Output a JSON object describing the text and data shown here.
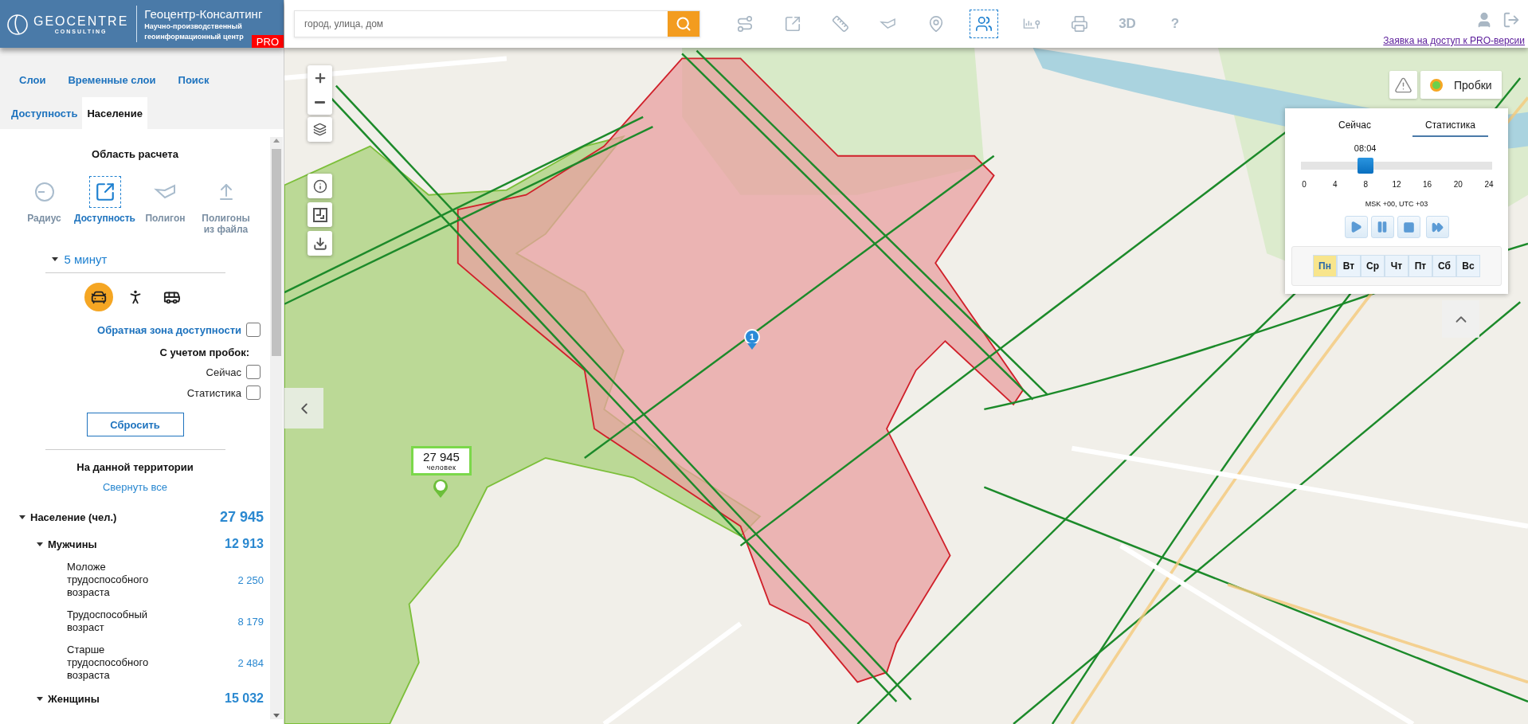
{
  "header": {
    "brand": "GEOCENTRE",
    "brand_sub": "CONSULTING",
    "title": "Геоцентр-Консалтинг",
    "subtitle_1": "Научно-производственный",
    "subtitle_2": "геоинформационный центр",
    "badge": "PRO"
  },
  "search": {
    "placeholder": "город, улица, дом"
  },
  "toolbar": {
    "tools": [
      {
        "selected": false
      },
      {
        "selected": false
      },
      {
        "selected": false
      },
      {
        "selected": false
      },
      {
        "selected": false
      },
      {
        "selected": true
      },
      {
        "selected": false
      },
      {
        "selected": false
      }
    ],
    "text_tools": [
      {
        "label": "3D"
      },
      {
        "label": "?"
      }
    ],
    "pro_link": "Заявка на доступ к PRO-версии"
  },
  "sidebar": {
    "tabs_row_1": [
      {
        "label": "Слои",
        "selected": false
      },
      {
        "label": "Временные слои",
        "selected": false
      },
      {
        "label": "Поиск",
        "selected": false
      }
    ],
    "tabs_row_2": [
      {
        "label": "Доступность",
        "selected": false
      },
      {
        "label": "Население",
        "selected": true
      }
    ],
    "area_title": "Область расчета",
    "area_modes": [
      {
        "label": "Радиус",
        "selected": false
      },
      {
        "label": "Доступность",
        "selected": true
      },
      {
        "label": "Полигон",
        "selected": false
      },
      {
        "label": "Полигоны из файла",
        "selected": false
      }
    ],
    "duration": "5 минут",
    "transport": [
      {
        "selected": true
      },
      {
        "selected": false
      },
      {
        "selected": false
      }
    ],
    "reverse_zone": {
      "label": "Обратная зона доступности",
      "checked": false
    },
    "traffic_title": "С учетом пробок:",
    "traffic_options": [
      {
        "label": "Сейчас",
        "checked": false
      },
      {
        "label": "Статистика",
        "checked": false
      }
    ],
    "reset_button": "Сбросить",
    "stats_title": "На данной территории",
    "collapse_link": "Свернуть все",
    "tree": [
      {
        "label": "Население (чел.)",
        "value": "27 945",
        "expanded": true,
        "children": [
          {
            "label": "Мужчины",
            "value": "12 913",
            "expanded": true,
            "children": [
              {
                "label": "Моложе трудоспособного возраста",
                "value": "2 250"
              },
              {
                "label": "Трудоспособный возраст",
                "value": "8 179"
              },
              {
                "label": "Старше трудоспособного возраста",
                "value": "2 484"
              }
            ]
          },
          {
            "label": "Женщины",
            "value": "15 032",
            "expanded": true
          }
        ]
      }
    ]
  },
  "map": {
    "popup": {
      "value": "27 945",
      "unit": "человек"
    },
    "marker": "1",
    "traffic_button": "Пробки",
    "traffic_panel": {
      "tabs": [
        {
          "label": "Сейчас",
          "selected": false
        },
        {
          "label": "Статистика",
          "selected": true
        }
      ],
      "time": "08:04",
      "level": 0.336,
      "ticks": [
        "0",
        "4",
        "8",
        "12",
        "16",
        "20",
        "24"
      ],
      "timezone": "MSK +00, UTC +03",
      "days": [
        {
          "label": "Пн",
          "selected": true
        },
        {
          "label": "Вт",
          "selected": false
        },
        {
          "label": "Ср",
          "selected": false
        },
        {
          "label": "Чт",
          "selected": false
        },
        {
          "label": "Пт",
          "selected": false
        },
        {
          "label": "Сб",
          "selected": false
        },
        {
          "label": "Вс",
          "selected": false
        }
      ]
    }
  }
}
